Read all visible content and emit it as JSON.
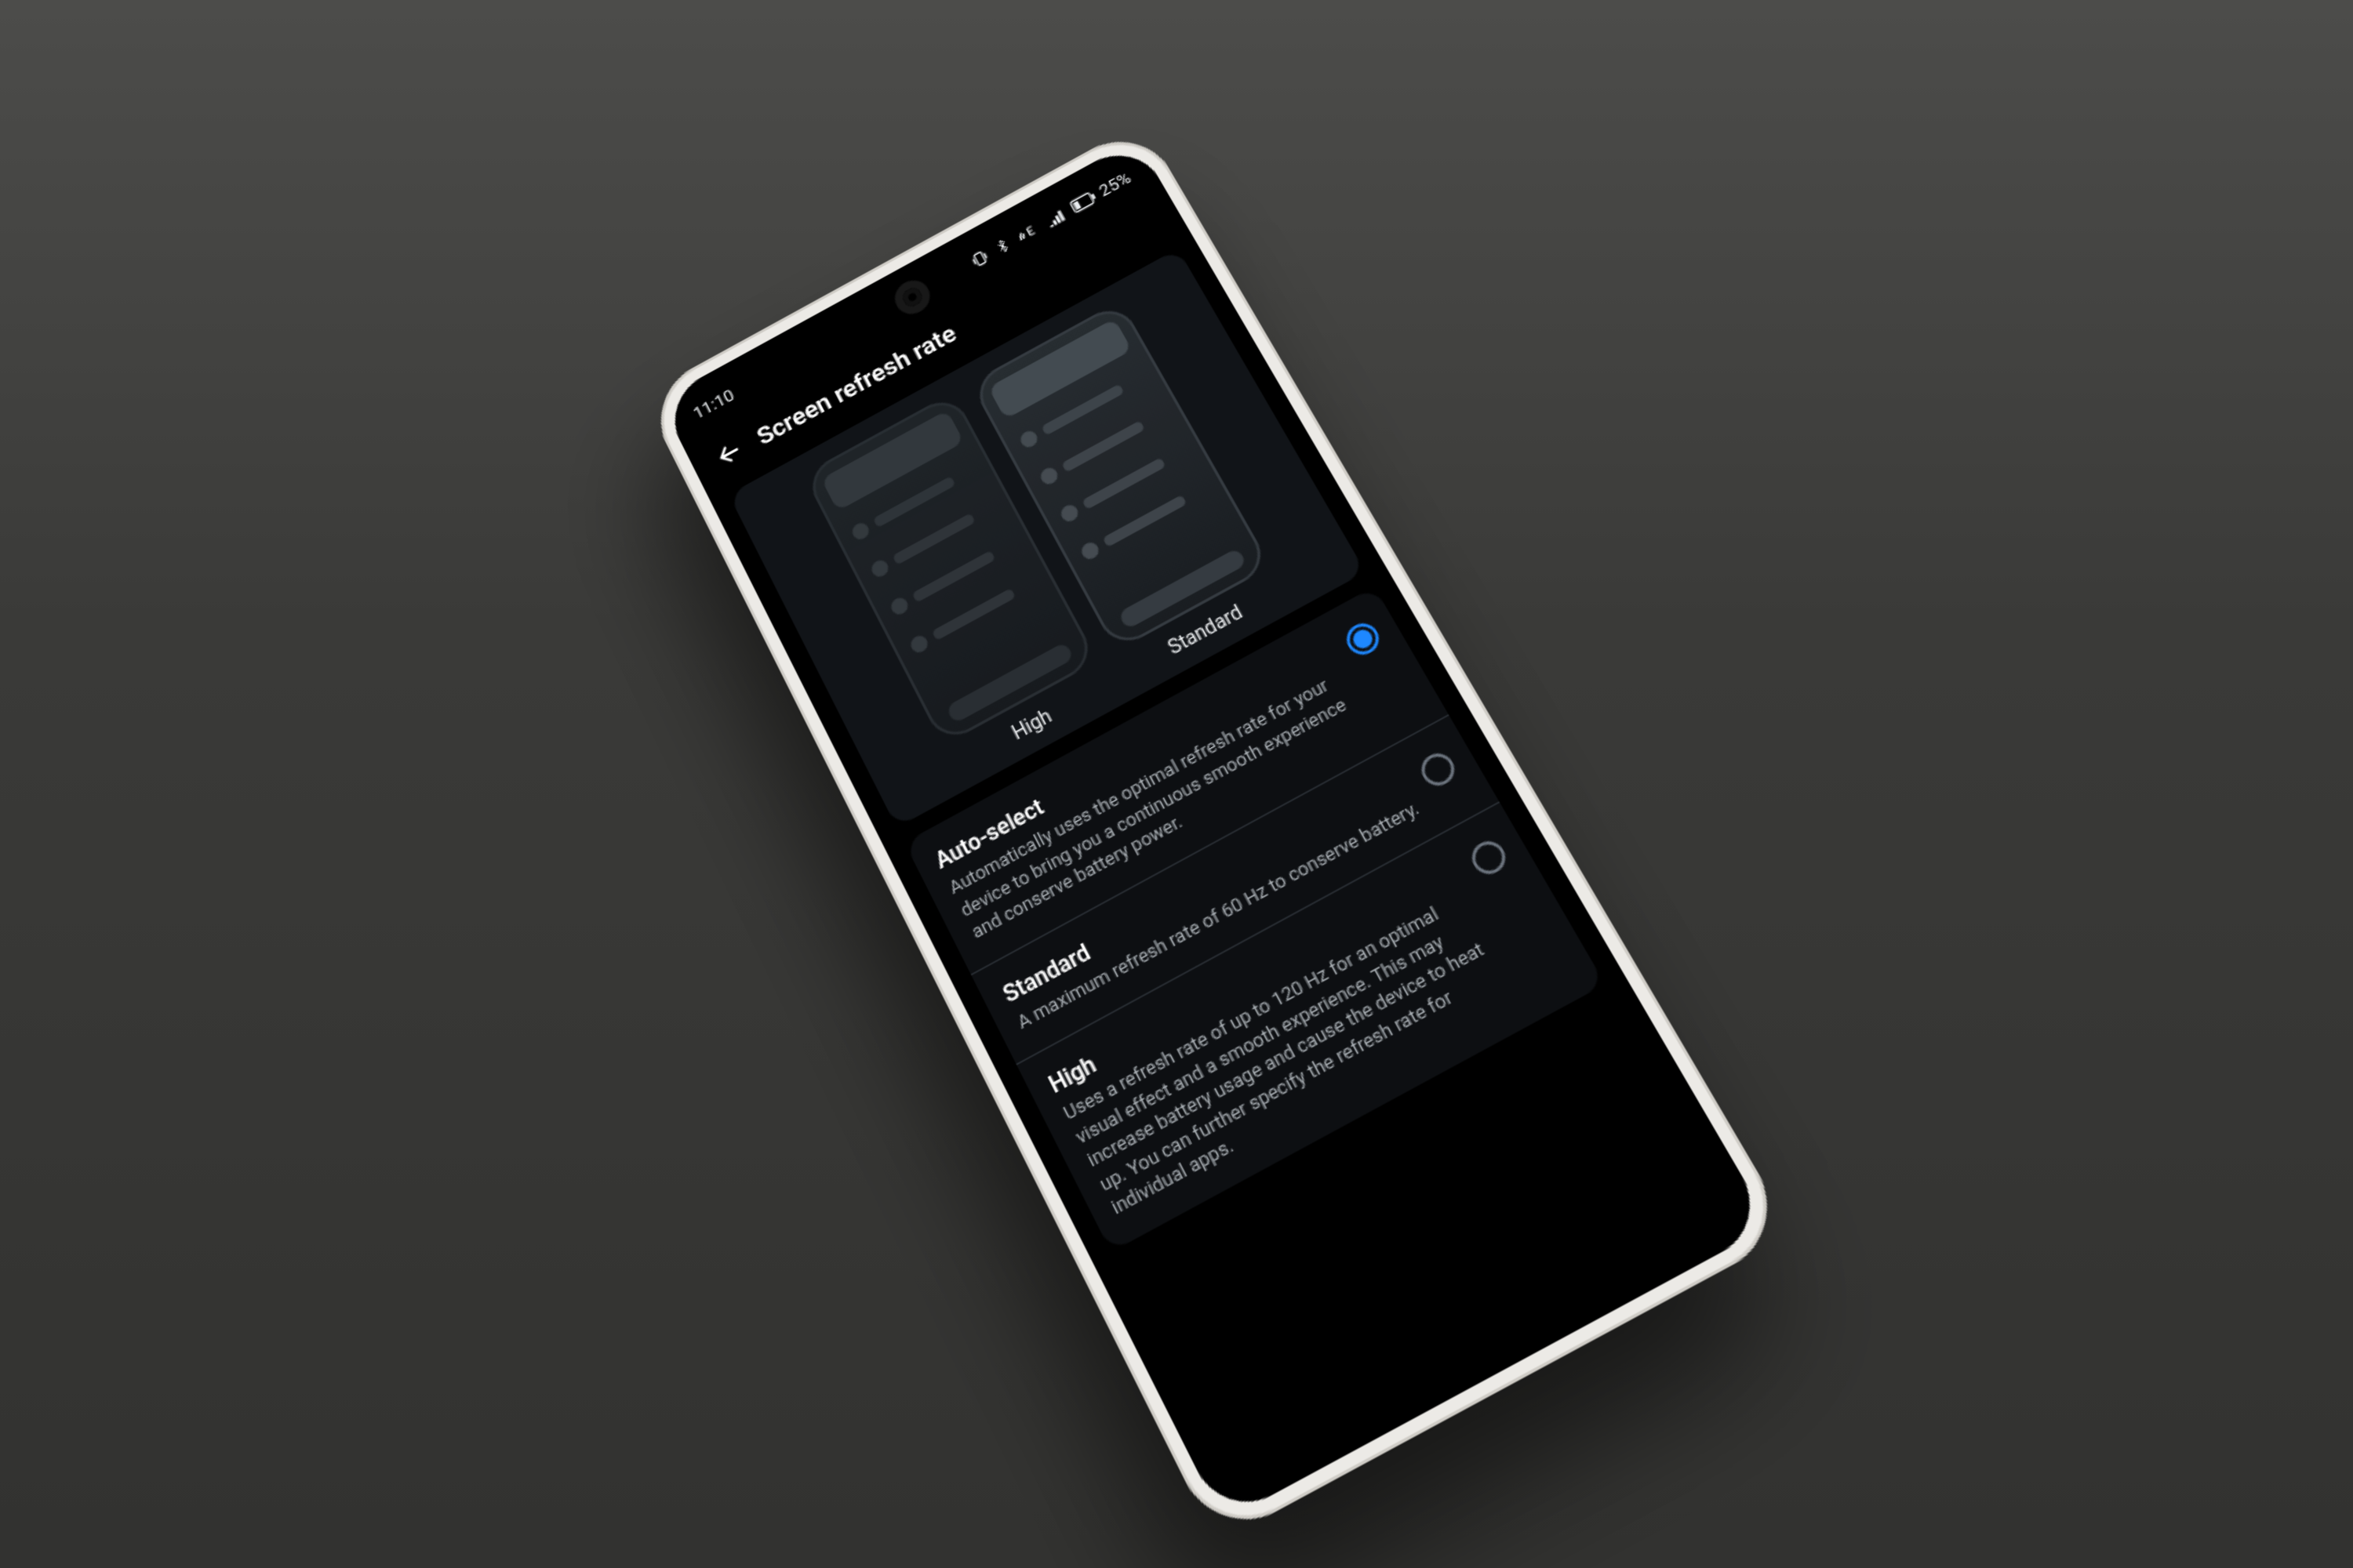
{
  "status_bar": {
    "time": "11:10",
    "battery_text": "25%"
  },
  "header": {
    "title": "Screen refresh rate"
  },
  "previews": {
    "high_label": "High",
    "standard_label": "Standard"
  },
  "options": {
    "auto": {
      "title": "Auto-select",
      "desc": "Automatically uses the optimal refresh rate for your device to bring you a continuous smooth experience and conserve battery power.",
      "selected": true
    },
    "standard": {
      "title": "Standard",
      "desc": "A maximum refresh rate of 60 Hz to conserve battery.",
      "selected": false
    },
    "high": {
      "title": "High",
      "desc": "Uses a refresh rate of up to 120 Hz for an optimal visual effect and a smooth experience. This may increase battery usage and cause the device to heat up. You can further specify the refresh rate for individual apps.",
      "selected": false
    }
  }
}
